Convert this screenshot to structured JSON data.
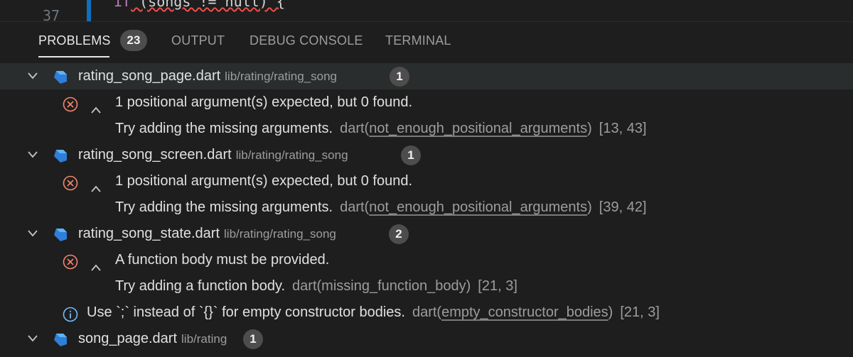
{
  "editor": {
    "line_number": "37",
    "code_keyword": "if",
    "code_rest": " (songs != null) {"
  },
  "panel": {
    "tabs": [
      {
        "label": "PROBLEMS",
        "badge": "23",
        "active": true
      },
      {
        "label": "OUTPUT"
      },
      {
        "label": "DEBUG CONSOLE"
      },
      {
        "label": "TERMINAL"
      }
    ]
  },
  "problems": [
    {
      "file": "rating_song_page.dart",
      "path": "lib/rating/rating_song",
      "count": "1",
      "items": [
        {
          "severity": "error",
          "message": "1 positional argument(s) expected, but 0 found.",
          "hint": "Try adding the missing arguments.",
          "source_prefix": "dart(",
          "code": "not_enough_positional_arguments",
          "source_suffix": ")",
          "position": "[13, 43]"
        }
      ]
    },
    {
      "file": "rating_song_screen.dart",
      "path": "lib/rating/rating_song",
      "count": "1",
      "items": [
        {
          "severity": "error",
          "message": "1 positional argument(s) expected, but 0 found.",
          "hint": "Try adding the missing arguments.",
          "source_prefix": "dart(",
          "code": "not_enough_positional_arguments",
          "source_suffix": ")",
          "position": "[39, 42]"
        }
      ]
    },
    {
      "file": "rating_song_state.dart",
      "path": "lib/rating/rating_song",
      "count": "2",
      "items": [
        {
          "severity": "error",
          "message": "A function body must be provided.",
          "hint": "Try adding a function body.",
          "source": "dart(missing_function_body)",
          "position": "[21, 3]"
        },
        {
          "severity": "info",
          "message": "Use `;` instead of `{}` for empty constructor bodies.",
          "source_prefix": "dart(",
          "code": "empty_constructor_bodies",
          "source_suffix": ")",
          "position": "[21, 3]"
        }
      ]
    },
    {
      "file": "song_page.dart",
      "path": "lib/rating",
      "count": "1"
    }
  ],
  "colors": {
    "error": "#f48771",
    "info": "#75beff",
    "dart_icon": "#2f7ed8",
    "badge_bg": "#4d4d4d"
  }
}
